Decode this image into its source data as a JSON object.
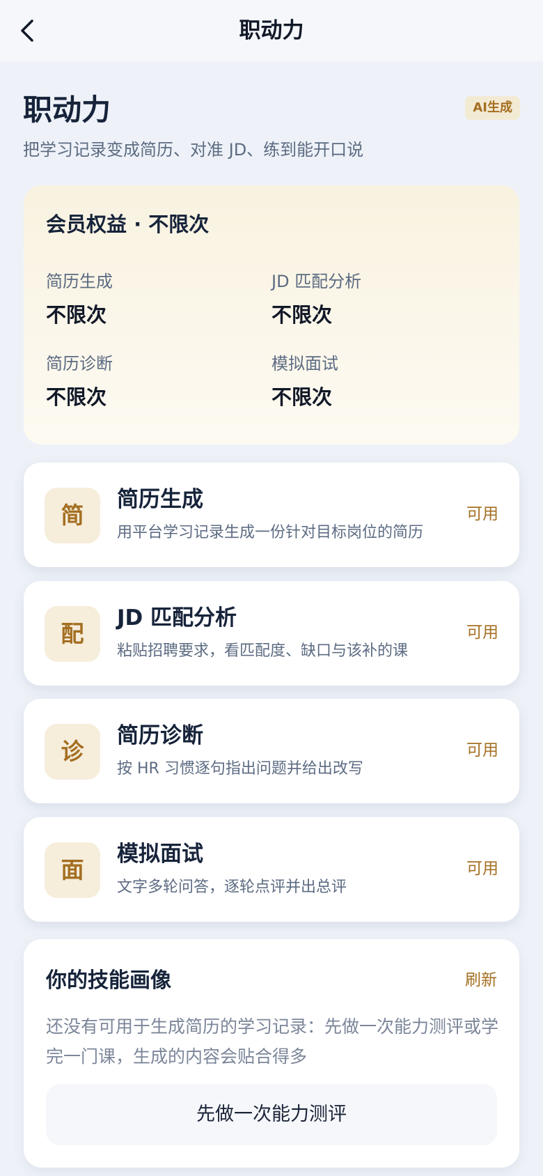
{
  "nav": {
    "title": "职动力"
  },
  "hero": {
    "title": "职动力",
    "badge": "AI生成",
    "subtitle": "把学习记录变成简历、对准 JD、练到能开口说"
  },
  "membership": {
    "title": "会员权益 · 不限次",
    "quotas": [
      {
        "label": "简历生成",
        "value": "不限次"
      },
      {
        "label": "JD 匹配分析",
        "value": "不限次"
      },
      {
        "label": "简历诊断",
        "value": "不限次"
      },
      {
        "label": "模拟面试",
        "value": "不限次"
      }
    ]
  },
  "features": [
    {
      "icon_char": "简",
      "title": "简历生成",
      "desc": "用平台学习记录生成一份针对目标岗位的简历",
      "status": "可用"
    },
    {
      "icon_char": "配",
      "title": "JD 匹配分析",
      "desc": "粘贴招聘要求，看匹配度、缺口与该补的课",
      "status": "可用"
    },
    {
      "icon_char": "诊",
      "title": "简历诊断",
      "desc": "按 HR 习惯逐句指出问题并给出改写",
      "status": "可用"
    },
    {
      "icon_char": "面",
      "title": "模拟面试",
      "desc": "文字多轮问答，逐轮点评并出总评",
      "status": "可用"
    }
  ],
  "skill_profile": {
    "title": "你的技能画像",
    "refresh_label": "刷新",
    "description": "还没有可用于生成简历的学习记录：先做一次能力测评或学完一门课，生成的内容会贴合得多",
    "cta_label": "先做一次能力测评"
  },
  "colors": {
    "accent": "#a46f22",
    "page_bg": "#eef2f8",
    "icon_bg": "#f6eddb"
  }
}
